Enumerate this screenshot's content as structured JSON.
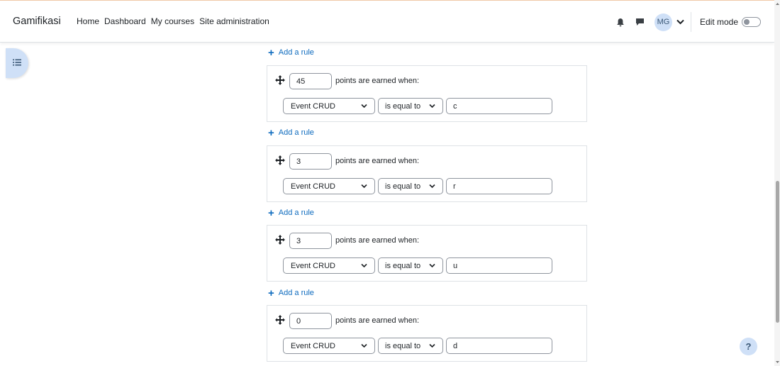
{
  "header": {
    "brand": "Gamifikasi",
    "nav": [
      "Home",
      "Dashboard",
      "My courses",
      "Site administration"
    ],
    "avatar_initials": "MG",
    "edit_mode_label": "Edit mode",
    "edit_mode_on": false
  },
  "add_rule_label": "Add a rule",
  "rules": [
    {
      "points": "45",
      "earned_label": "points are earned when:",
      "event": "Event CRUD",
      "operator": "is equal to",
      "value": "c"
    },
    {
      "points": "3",
      "earned_label": "points are earned when:",
      "event": "Event CRUD",
      "operator": "is equal to",
      "value": "r"
    },
    {
      "points": "3",
      "earned_label": "points are earned when:",
      "event": "Event CRUD",
      "operator": "is equal to",
      "value": "u"
    },
    {
      "points": "0",
      "earned_label": "points are earned when:",
      "event": "Event CRUD",
      "operator": "is equal to",
      "value": "d"
    }
  ],
  "help_button": "?",
  "icons": {
    "drawer": "list-icon",
    "notifications": "bell-icon",
    "messages": "chat-icon",
    "user_menu": "chevron-down-icon",
    "drag": "move-icon",
    "help": "question-icon"
  },
  "colors": {
    "accent": "#0f6cbf",
    "avatar_bg": "#cfe0f7",
    "border": "#dee2e6",
    "input_border": "#8f959e"
  }
}
